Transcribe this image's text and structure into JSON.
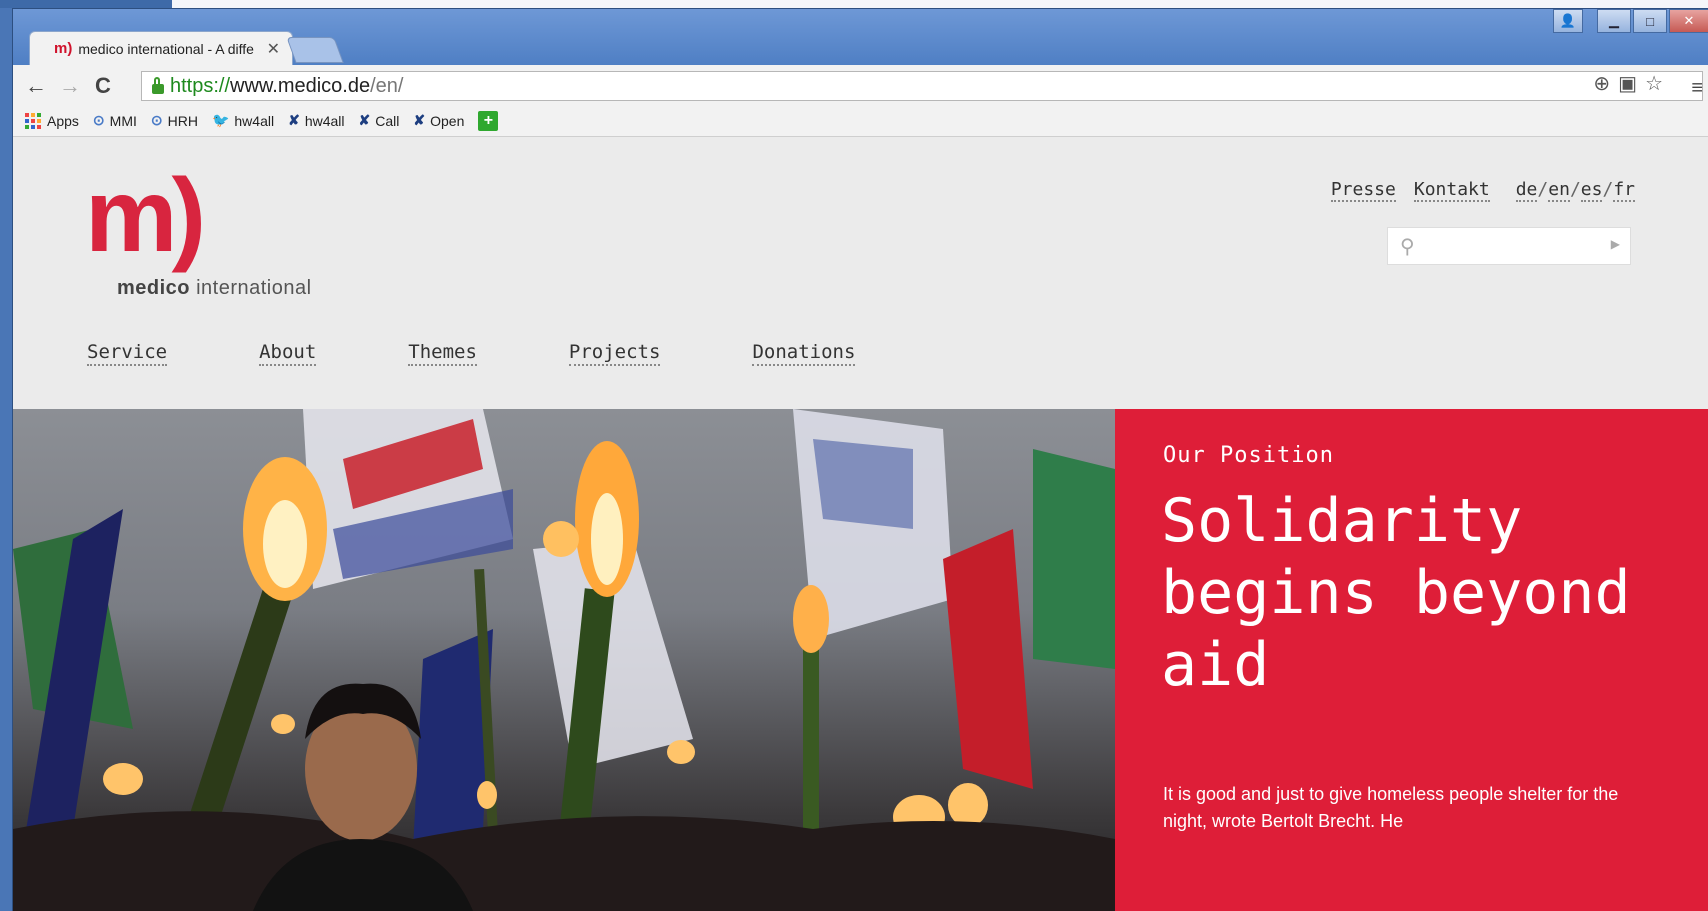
{
  "browser": {
    "tab_title": "medico international - A diffe",
    "tab_favicon": "m)",
    "url_scheme": "https://",
    "url_domain": "www.medico.de",
    "url_path": "/en/",
    "bookmarks": [
      {
        "label": "Apps",
        "icon": "apps-grid-icon"
      },
      {
        "label": "MMI",
        "icon": "circle-arrow-icon"
      },
      {
        "label": "HRH",
        "icon": "circle-arrow-icon"
      },
      {
        "label": "hw4all",
        "icon": "twitter-bird-icon"
      },
      {
        "label": "hw4all",
        "icon": "cross-tools-icon"
      },
      {
        "label": "Call",
        "icon": "cross-tools-icon"
      },
      {
        "label": "Open",
        "icon": "cross-tools-icon"
      }
    ]
  },
  "site": {
    "logo_mark": "m)",
    "logo_word1": "medico",
    "logo_word2": "international",
    "top_links": [
      "Presse",
      "Kontakt"
    ],
    "languages": [
      "de",
      "en",
      "es",
      "fr"
    ],
    "nav": [
      "Service",
      "About",
      "Themes",
      "Projects",
      "Donations"
    ],
    "brand_color": "#de1e38"
  },
  "hero": {
    "kicker": "Our Position",
    "headline": "Solidarity begins beyond aid",
    "lede": "It is good and just to give homeless people shelter for the night, wrote Bertolt Brecht. He"
  }
}
